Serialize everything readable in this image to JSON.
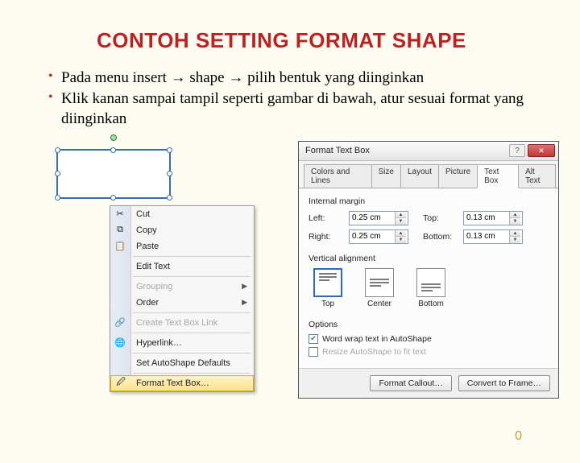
{
  "title": "CONTOH SETTING FORMAT SHAPE",
  "bullets": {
    "b1_a": "Pada menu insert ",
    "b1_b": " shape ",
    "b1_c": " pilih bentuk yang diinginkan",
    "b2": "Klik kanan sampai tampil seperti gambar di bawah, atur sesuai format yang diinginkan",
    "arrow": "→"
  },
  "context_menu": {
    "cut": "Cut",
    "copy": "Copy",
    "paste": "Paste",
    "edit_text": "Edit Text",
    "grouping": "Grouping",
    "order": "Order",
    "create_link": "Create Text Box Link",
    "hyperlink": "Hyperlink…",
    "set_defaults": "Set AutoShape Defaults",
    "format_textbox": "Format Text Box…"
  },
  "dialog": {
    "title": "Format Text Box",
    "tabs": {
      "colors": "Colors and Lines",
      "size": "Size",
      "layout": "Layout",
      "picture": "Picture",
      "textbox": "Text Box",
      "altText": "Alt Text"
    },
    "internal_margin": "Internal margin",
    "left": "Left:",
    "right": "Right:",
    "top": "Top:",
    "bottom": "Bottom:",
    "left_val": "0.25 cm",
    "right_val": "0.25 cm",
    "top_val": "0.13 cm",
    "bottom_val": "0.13 cm",
    "va_label": "Vertical alignment",
    "va_top": "Top",
    "va_center": "Center",
    "va_bottom": "Bottom",
    "options": "Options",
    "opt_wrap": "Word wrap text in AutoShape",
    "opt_resize": "Resize AutoShape to fit text",
    "format_callout": "Format Callout…",
    "convert_frame": "Convert to Frame…"
  },
  "page_num": "0"
}
